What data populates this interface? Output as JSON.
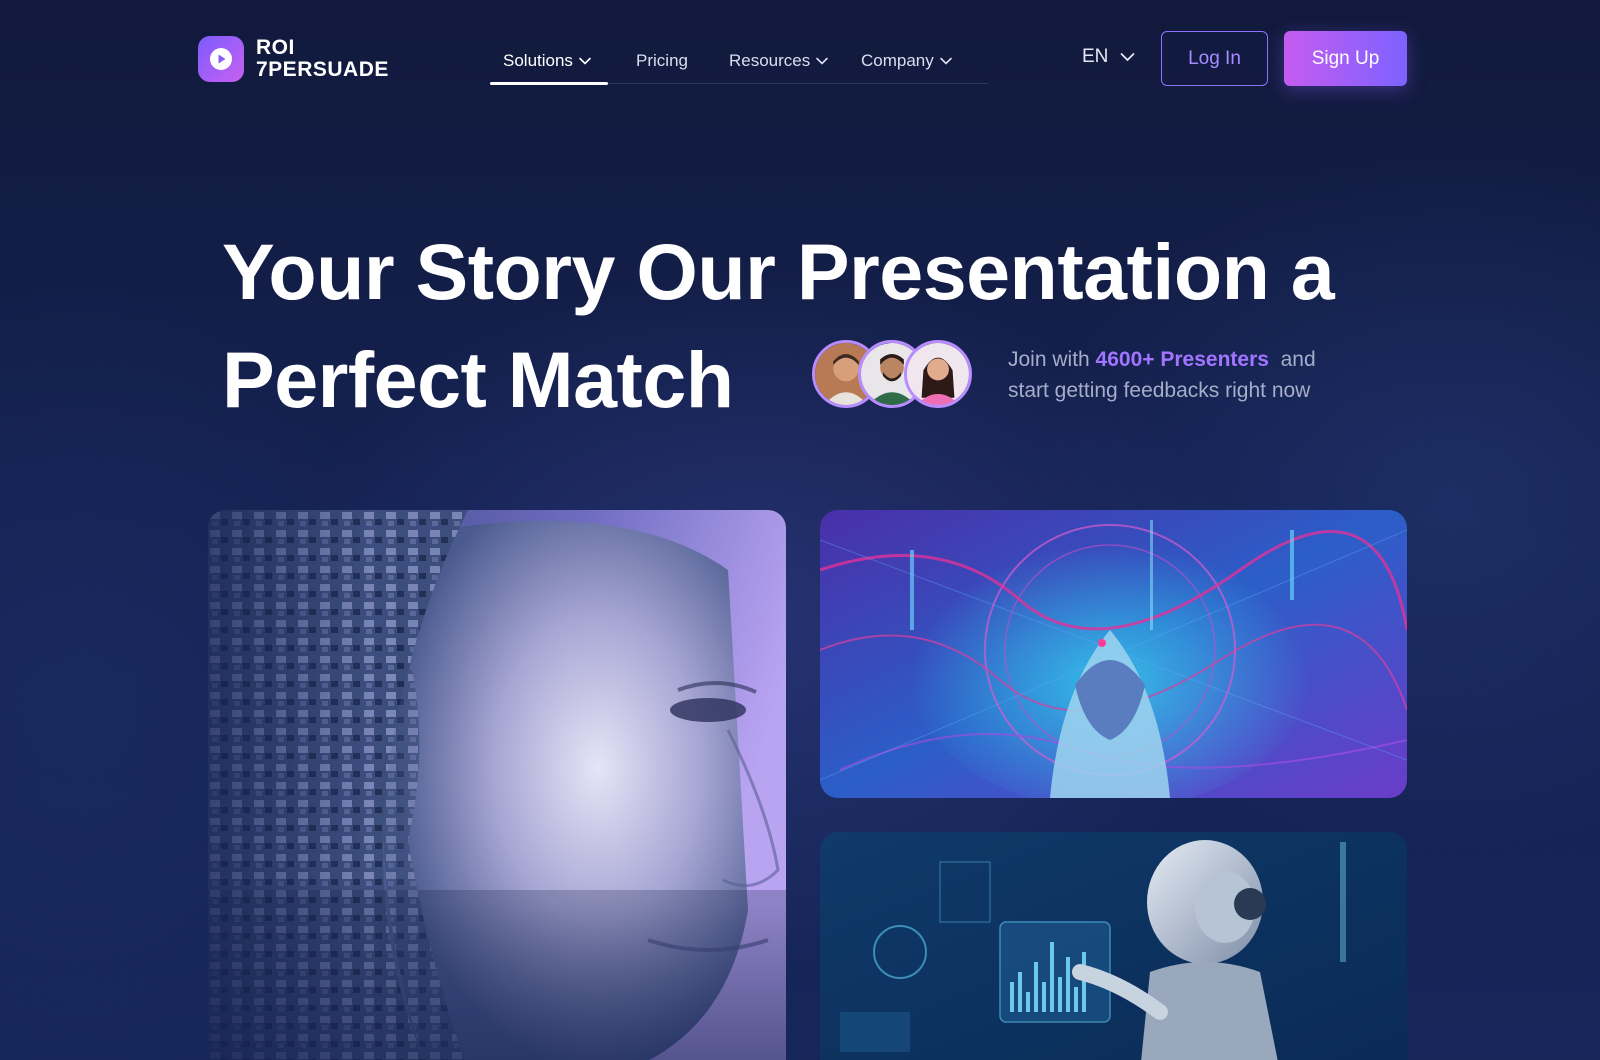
{
  "brand": {
    "name_line1": "ROI",
    "name_line2": "7PERSUADE",
    "icon": "play-icon"
  },
  "nav": {
    "items": [
      {
        "label": "Solutions",
        "has_dropdown": true,
        "active": true
      },
      {
        "label": "Pricing",
        "has_dropdown": false,
        "active": false
      },
      {
        "label": "Resources",
        "has_dropdown": true,
        "active": false
      },
      {
        "label": "Company",
        "has_dropdown": true,
        "active": false
      }
    ],
    "language": "EN",
    "login_label": "Log In",
    "signup_label": "Sign Up"
  },
  "hero": {
    "headline_line1": "Your Story Our Presentation a",
    "headline_line2": "Perfect Match",
    "join_prefix": "Join with ",
    "join_highlight": "4600+ Presenters",
    "join_suffix": "  and",
    "join_line2": "start getting feedbacks right now",
    "avatar_count": 3
  },
  "colors": {
    "accent": "#a374ff",
    "background": "#142150",
    "signup_gradient_start": "#c45cf0",
    "signup_gradient_end": "#7d62ff"
  },
  "gallery": [
    {
      "name": "fragmented-face-image"
    },
    {
      "name": "hooded-figure-image"
    },
    {
      "name": "robot-chart-image"
    }
  ]
}
